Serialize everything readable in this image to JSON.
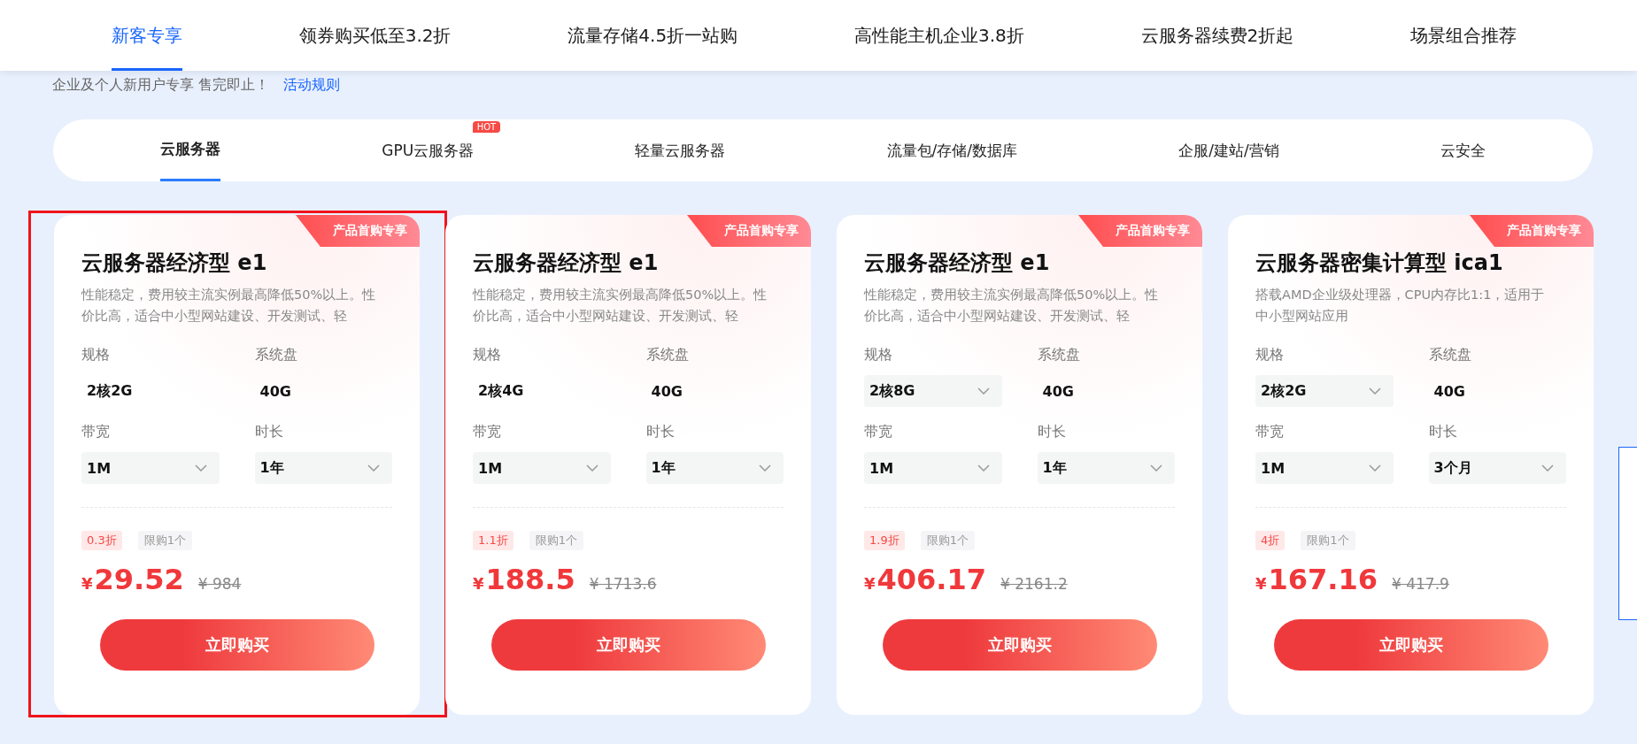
{
  "top_nav": [
    {
      "label": "新客专享",
      "selected": true
    },
    {
      "label": "领券购买低至3.2折",
      "selected": false
    },
    {
      "label": "流量存储4.5折一站购",
      "selected": false
    },
    {
      "label": "高性能主机企业3.8折",
      "selected": false
    },
    {
      "label": "云服务器续费2折起",
      "selected": false
    },
    {
      "label": "场景组合推荐",
      "selected": false
    }
  ],
  "subtitle": {
    "text": "企业及个人新用户专享 售完即止！",
    "link": "活动规则"
  },
  "category_tabs": [
    {
      "label": "云服务器",
      "selected": true
    },
    {
      "label": "GPU云服务器",
      "selected": false,
      "badge": "HOT"
    },
    {
      "label": "轻量云服务器",
      "selected": false
    },
    {
      "label": "流量包/存储/数据库",
      "selected": false
    },
    {
      "label": "企服/建站/营销",
      "selected": false
    },
    {
      "label": "云安全",
      "selected": false
    }
  ],
  "cards": [
    {
      "highlighted": true,
      "ribbon": "产品首购专享",
      "title": "云服务器经济型 e1",
      "description": "性能稳定，费用较主流实例最高降低50%以上。性价比高，适合中小型网站建设、开发测试、轻",
      "fields": [
        {
          "label": "规格",
          "value": "2核2G",
          "dropdown": false
        },
        {
          "label": "系统盘",
          "value": "40G",
          "dropdown": false
        },
        {
          "label": "带宽",
          "value": "1M",
          "dropdown": true
        },
        {
          "label": "时长",
          "value": "1年",
          "dropdown": true
        }
      ],
      "discount": "0.3折",
      "limit": "限购1个",
      "currency": "¥",
      "price": "29.52",
      "original_price": "¥ 984",
      "button": "立即购买"
    },
    {
      "highlighted": false,
      "ribbon": "产品首购专享",
      "title": "云服务器经济型 e1",
      "description": "性能稳定，费用较主流实例最高降低50%以上。性价比高，适合中小型网站建设、开发测试、轻",
      "fields": [
        {
          "label": "规格",
          "value": "2核4G",
          "dropdown": false
        },
        {
          "label": "系统盘",
          "value": "40G",
          "dropdown": false
        },
        {
          "label": "带宽",
          "value": "1M",
          "dropdown": true
        },
        {
          "label": "时长",
          "value": "1年",
          "dropdown": true
        }
      ],
      "discount": "1.1折",
      "limit": "限购1个",
      "currency": "¥",
      "price": "188.5",
      "original_price": "¥ 1713.6",
      "button": "立即购买"
    },
    {
      "highlighted": false,
      "ribbon": "产品首购专享",
      "title": "云服务器经济型 e1",
      "description": "性能稳定，费用较主流实例最高降低50%以上。性价比高，适合中小型网站建设、开发测试、轻",
      "fields": [
        {
          "label": "规格",
          "value": "2核8G",
          "dropdown": true
        },
        {
          "label": "系统盘",
          "value": "40G",
          "dropdown": false
        },
        {
          "label": "带宽",
          "value": "1M",
          "dropdown": true
        },
        {
          "label": "时长",
          "value": "1年",
          "dropdown": true
        }
      ],
      "discount": "1.9折",
      "limit": "限购1个",
      "currency": "¥",
      "price": "406.17",
      "original_price": "¥ 2161.2",
      "button": "立即购买"
    },
    {
      "highlighted": false,
      "ribbon": "产品首购专享",
      "title": "云服务器密集计算型 ica1",
      "description": "搭载AMD企业级处理器，CPU内存比1:1，适用于中小型网站应用",
      "fields": [
        {
          "label": "规格",
          "value": "2核2G",
          "dropdown": true
        },
        {
          "label": "系统盘",
          "value": "40G",
          "dropdown": false
        },
        {
          "label": "带宽",
          "value": "1M",
          "dropdown": true
        },
        {
          "label": "时长",
          "value": "3个月",
          "dropdown": true
        }
      ],
      "discount": "4折",
      "limit": "限购1个",
      "currency": "¥",
      "price": "167.16",
      "original_price": "¥ 417.9",
      "button": "立即购买"
    }
  ],
  "side_panel": {
    "kind": "panel"
  }
}
